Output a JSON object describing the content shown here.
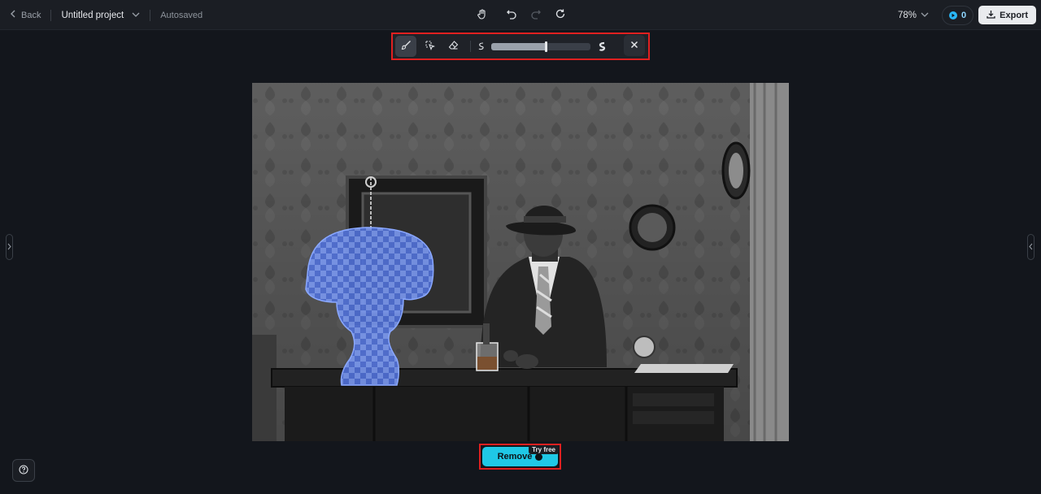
{
  "header": {
    "back_label": "Back",
    "project_name": "Untitled project",
    "autosave_status": "Autosaved",
    "zoom_level": "78%",
    "credits_count": "0",
    "export_label": "Export"
  },
  "toolbar": {
    "brush_size": 0.55,
    "tools": [
      "brush-icon",
      "smart-select-icon",
      "eraser-icon"
    ]
  },
  "actions": {
    "remove_label": "Remove",
    "try_free_badge": "Try free"
  },
  "colors": {
    "accent": "#1fc8e6",
    "highlight_border": "#e02020",
    "mask": "#5a82ff",
    "background": "#13161c"
  }
}
